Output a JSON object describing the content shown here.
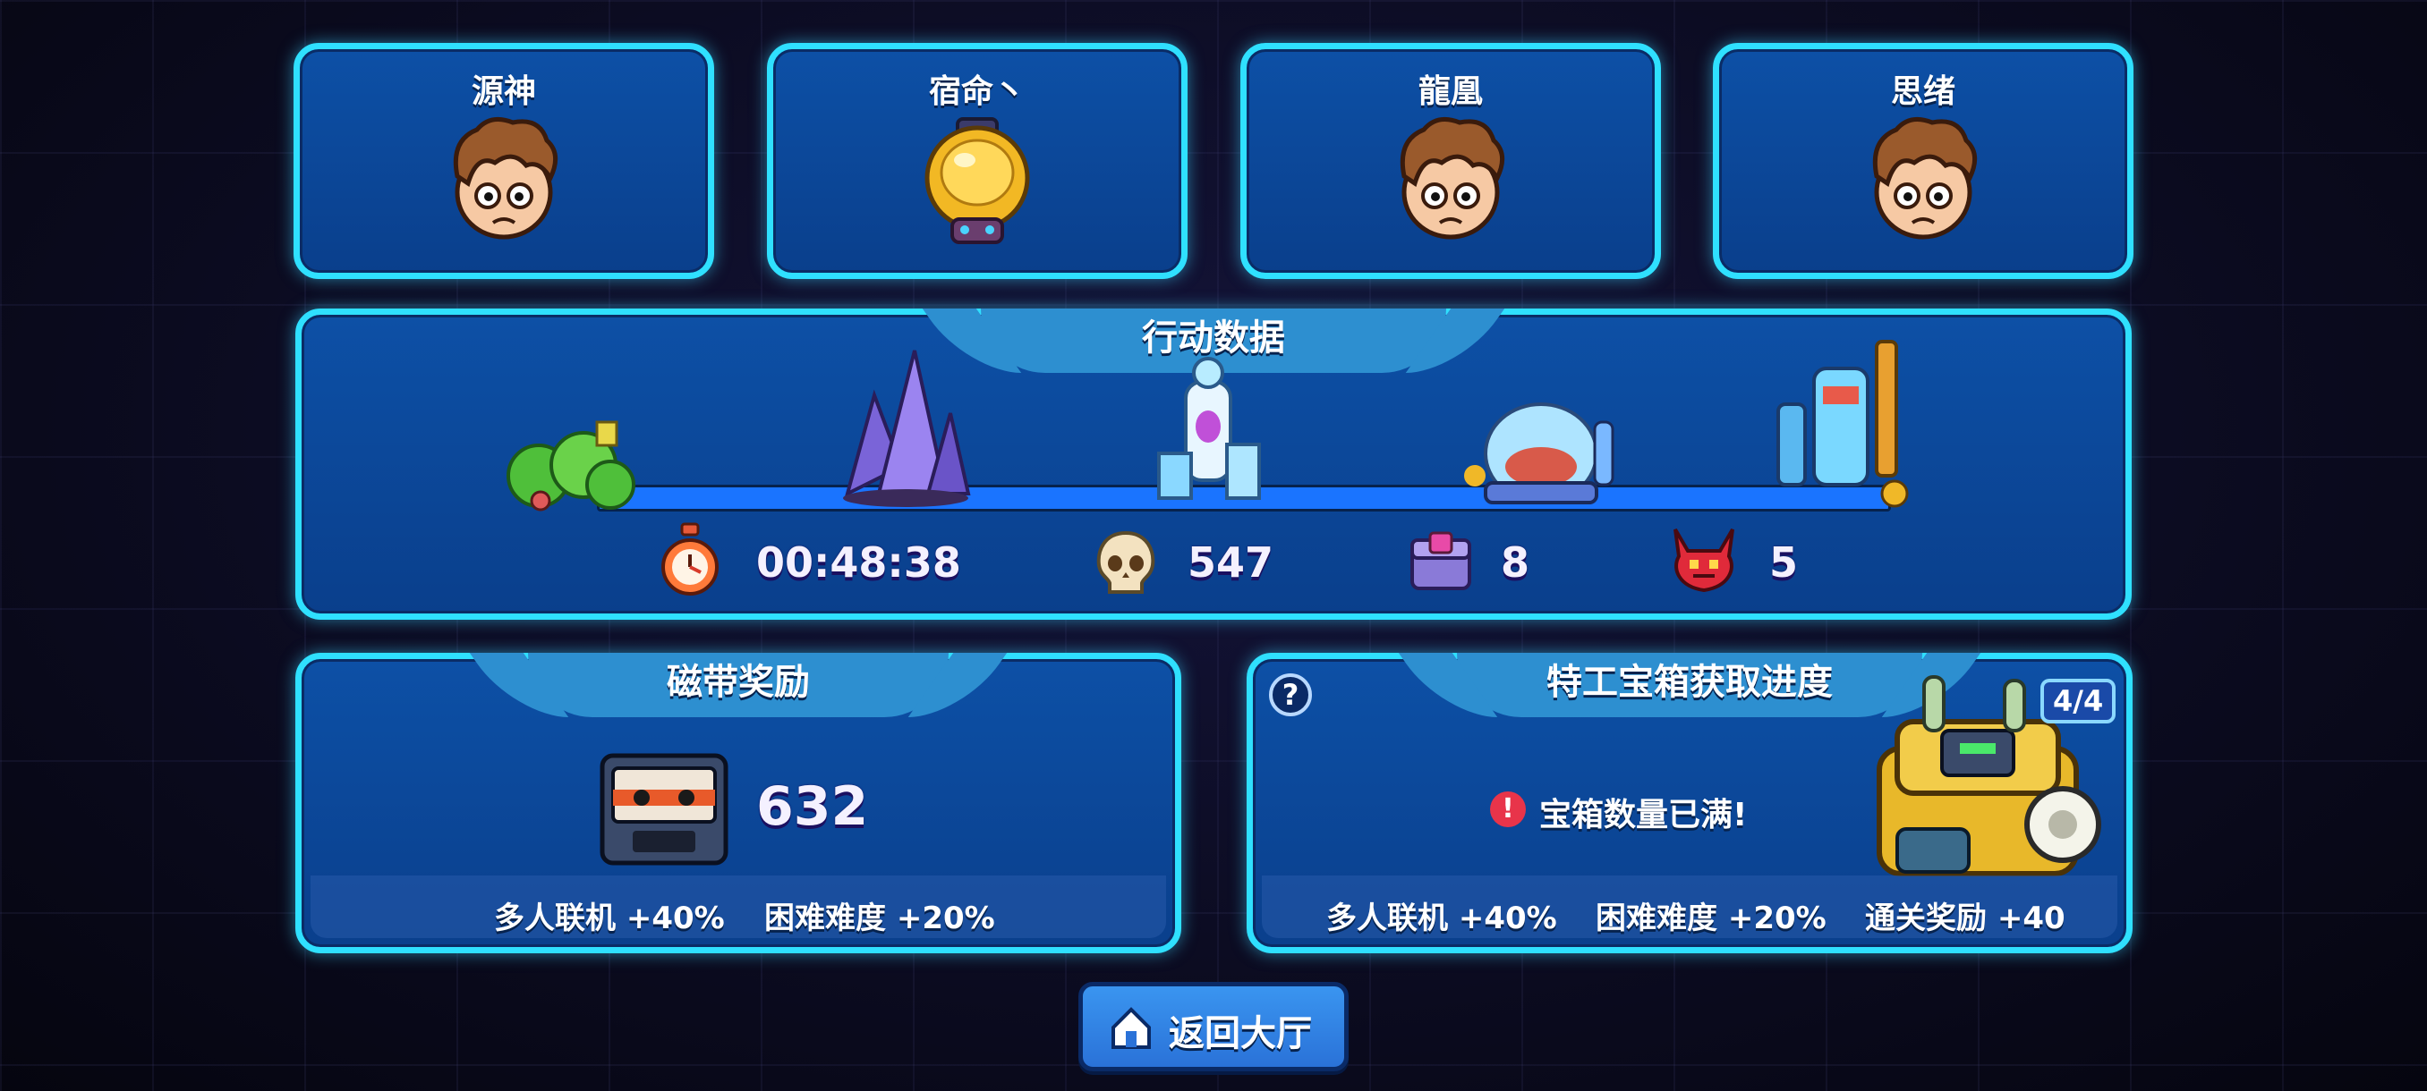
{
  "players": [
    {
      "name": "源神",
      "avatar": "brown-hair-boy-icon"
    },
    {
      "name": "宿命丶",
      "avatar": "gold-helmet-robot-icon"
    },
    {
      "name": "龍凰",
      "avatar": "brown-hair-boy-icon"
    },
    {
      "name": "思绪",
      "avatar": "brown-hair-boy-icon"
    }
  ],
  "action_data": {
    "title": "行动数据",
    "stages": [
      "forest-stage-icon",
      "crystal-stage-icon",
      "ice-lab-stage-icon",
      "dome-stage-icon",
      "machine-stage-icon"
    ],
    "stats": {
      "time": {
        "icon": "stopwatch-icon",
        "value": "00:48:38"
      },
      "kills": {
        "icon": "skull-icon",
        "value": "547"
      },
      "chests": {
        "icon": "chest-icon",
        "value": "8"
      },
      "bosses": {
        "icon": "demon-icon",
        "value": "5"
      }
    }
  },
  "tape_reward": {
    "title": "磁带奖励",
    "icon": "cassette-tape-icon",
    "value": "632",
    "bonus_multiplayer": "多人联机 +40%",
    "bonus_hard": "困难难度 +20%"
  },
  "chest_progress": {
    "title": "特工宝箱获取进度",
    "help": "?",
    "warning": "宝箱数量已满!",
    "progress": "4/4",
    "bonus_multiplayer": "多人联机 +40%",
    "bonus_hard": "困难难度 +20%",
    "bonus_clear": "通关奖励 +40"
  },
  "return_button": {
    "label": "返回大厅",
    "icon": "home-icon"
  },
  "colors": {
    "panel_border": "#2fe0ff",
    "panel_fill": "#0d50a6",
    "tab": "#2d8fd0",
    "button": "#2a7fe0"
  }
}
